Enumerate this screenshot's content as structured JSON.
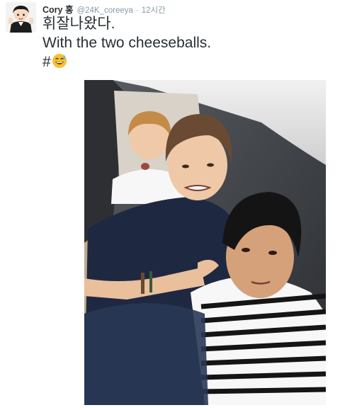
{
  "tweet": {
    "author_name": "Cory 홍",
    "author_handle": "@24K_coreeya",
    "separator": "·",
    "time": "12시간",
    "text_line1": "휘잘나왔다.",
    "text_line2": "With the two cheeseballs.",
    "hashtag_symbol": "#",
    "emoji": "smiling-face-with-open-mouth-and-cold-sweat"
  },
  "colors": {
    "text_primary": "#292f33",
    "text_secondary": "#8899a6",
    "background": "#ffffff"
  },
  "photo": {
    "description_icon": "selfie-photo"
  }
}
